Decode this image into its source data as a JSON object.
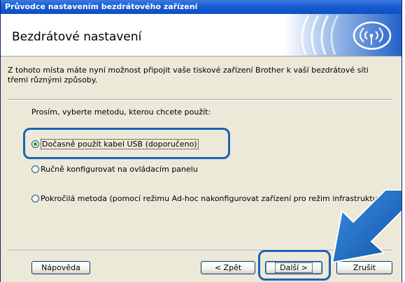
{
  "window": {
    "title": "Průvodce nastavením bezdrátového zařízení",
    "header_title": "Bezdrátové nastavení"
  },
  "intro_text": "Z tohoto místa máte nyní možnost připojit vaše tiskové zařízení Brother k vaší bezdrátové síti třemi různými způsoby.",
  "prompt_text": "Prosím, vyberte metodu, kterou chcete použít:",
  "options": [
    {
      "label": "Dočasně použít kabel USB (doporučeno)",
      "selected": true
    },
    {
      "label": "Ručně konfigurovat na ovládacím panelu",
      "selected": false
    },
    {
      "label": "Pokročilá metoda (pomocí režimu Ad-hoc nakonfigurovat zařízení pro režim infrastruktury)",
      "selected": false
    }
  ],
  "buttons": {
    "help": "Nápověda",
    "back": "< Zpět",
    "next": "Další >",
    "cancel": "Zrušit"
  },
  "colors": {
    "titlebar": "#0a4fc4",
    "callout": "#1a63b3",
    "arrow": "#1a6fc2",
    "radio_dot": "#21a121"
  },
  "icons": {
    "header": "wireless-signal-icon",
    "pointer": "arrow-pointer-icon"
  }
}
